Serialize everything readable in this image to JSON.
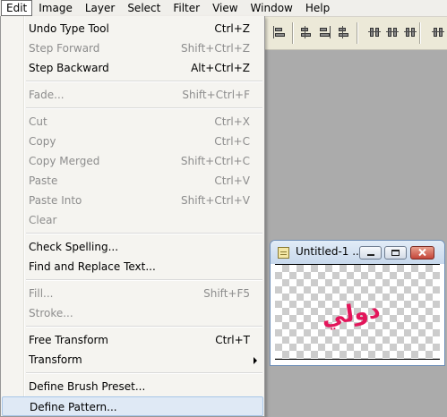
{
  "menubar": {
    "items": [
      "Edit",
      "Image",
      "Layer",
      "Select",
      "Filter",
      "View",
      "Window",
      "Help"
    ],
    "active": "Edit"
  },
  "edit_menu": {
    "groups": [
      [
        {
          "label": "Undo Type Tool",
          "shortcut": "Ctrl+Z",
          "enabled": true
        },
        {
          "label": "Step Forward",
          "shortcut": "Shift+Ctrl+Z",
          "enabled": false
        },
        {
          "label": "Step Backward",
          "shortcut": "Alt+Ctrl+Z",
          "enabled": true
        }
      ],
      [
        {
          "label": "Fade...",
          "shortcut": "Shift+Ctrl+F",
          "enabled": false
        }
      ],
      [
        {
          "label": "Cut",
          "shortcut": "Ctrl+X",
          "enabled": false
        },
        {
          "label": "Copy",
          "shortcut": "Ctrl+C",
          "enabled": false
        },
        {
          "label": "Copy Merged",
          "shortcut": "Shift+Ctrl+C",
          "enabled": false
        },
        {
          "label": "Paste",
          "shortcut": "Ctrl+V",
          "enabled": false
        },
        {
          "label": "Paste Into",
          "shortcut": "Shift+Ctrl+V",
          "enabled": false
        },
        {
          "label": "Clear",
          "shortcut": "",
          "enabled": false
        }
      ],
      [
        {
          "label": "Check Spelling...",
          "shortcut": "",
          "enabled": true
        },
        {
          "label": "Find and Replace Text...",
          "shortcut": "",
          "enabled": true
        }
      ],
      [
        {
          "label": "Fill...",
          "shortcut": "Shift+F5",
          "enabled": false
        },
        {
          "label": "Stroke...",
          "shortcut": "",
          "enabled": false
        }
      ],
      [
        {
          "label": "Free Transform",
          "shortcut": "Ctrl+T",
          "enabled": true
        },
        {
          "label": "Transform",
          "shortcut": "",
          "enabled": true,
          "submenu": true
        }
      ],
      [
        {
          "label": "Define Brush Preset...",
          "shortcut": "",
          "enabled": true
        },
        {
          "label": "Define Pattern...",
          "shortcut": "",
          "enabled": true,
          "highlighted": true
        }
      ]
    ]
  },
  "document_window": {
    "title": "Untitled-1 ...",
    "canvas_text": "دولي",
    "canvas_text_color": "#e3165b"
  },
  "options_bar": {
    "icons": [
      "align-left-edges-icon",
      "align-horizontal-centers-icon",
      "align-right-edges-icon",
      "align-top-edges-icon",
      "distribute-top-icon",
      "distribute-vertical-centers-icon",
      "distribute-bottom-icon",
      "distribute-left-icon"
    ]
  }
}
